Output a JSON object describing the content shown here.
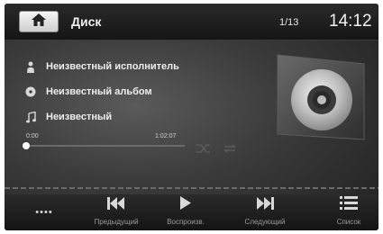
{
  "header": {
    "source_title": "Диск",
    "track_count": "1/13",
    "clock": "14:12"
  },
  "info": {
    "artist": "Неизвестный исполнитель",
    "album": "Неизвестный альбом",
    "title": "Неизвестный"
  },
  "playback": {
    "elapsed": "0:00",
    "total": "1:02:07",
    "progress": 0.0
  },
  "controls": {
    "more_label": "••••",
    "prev_label": "Предыдущий",
    "play_label": "Воспроизв.",
    "next_label": "Следующий",
    "list_label": "Список"
  },
  "icons": {
    "home": "home-icon",
    "artist": "person-icon",
    "album": "disc-icon",
    "title": "music-note-icon",
    "shuffle": "shuffle-icon",
    "repeat": "repeat-icon",
    "prev": "skip-previous-icon",
    "play": "play-icon",
    "next": "skip-next-icon",
    "list": "list-icon"
  }
}
